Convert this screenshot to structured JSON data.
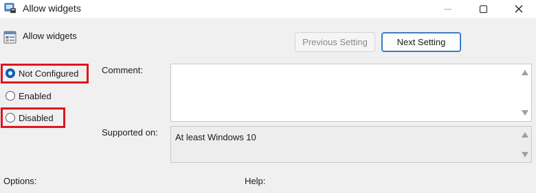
{
  "window": {
    "title": "Allow widgets",
    "icons": [
      "app-icon",
      "minimize-icon",
      "maximize-icon",
      "close-icon"
    ]
  },
  "policy": {
    "name": "Allow widgets",
    "icon": "policy-setting-icon"
  },
  "navigation": {
    "previous_label": "Previous Setting",
    "next_label": "Next Setting"
  },
  "state": {
    "options": [
      {
        "label": "Not Configured",
        "checked": true
      },
      {
        "label": "Enabled",
        "checked": false
      },
      {
        "label": "Disabled",
        "checked": false
      }
    ],
    "highlight_color": "#e0151c"
  },
  "comment": {
    "label": "Comment:",
    "value": ""
  },
  "supported": {
    "label": "Supported on:",
    "value": "At least Windows 10"
  },
  "panes": {
    "options_label": "Options:",
    "help_label": "Help:"
  },
  "colors": {
    "accent": "#0a5fb4",
    "window_bg": "#f0f0f0"
  }
}
